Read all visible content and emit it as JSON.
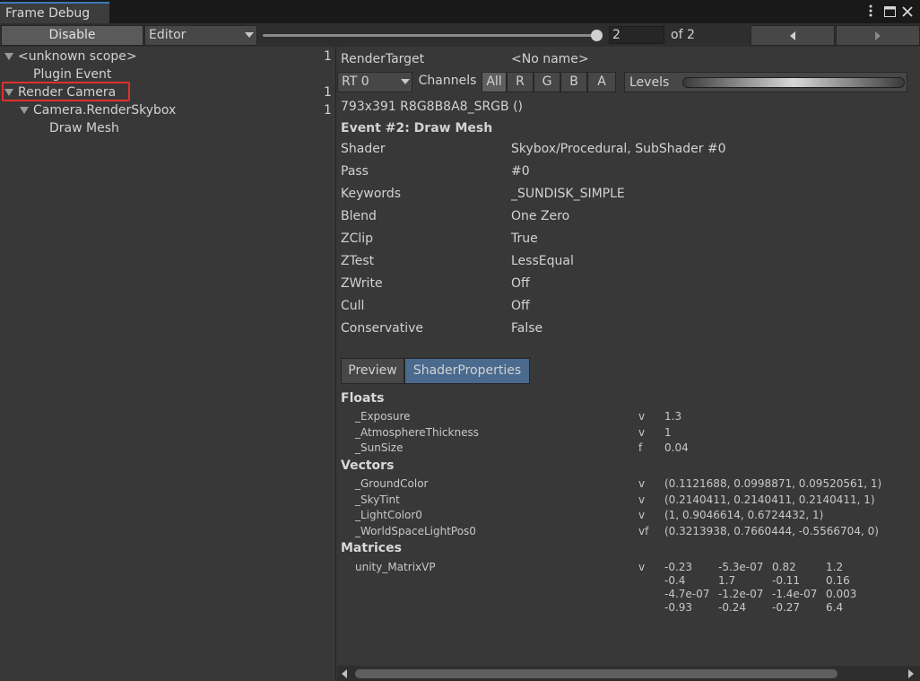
{
  "window": {
    "tab_title": "Frame Debug",
    "menu_icon": "kebab-menu-icon",
    "maximize_icon": "maximize-icon",
    "close_icon": "close-icon"
  },
  "toolbar": {
    "disable_label": "Disable",
    "editor_label": "Editor",
    "frame_value": "2",
    "frame_slider_fraction": 1.0,
    "of_label": "of 2",
    "prev_icon": "triangle-left-icon",
    "next_icon": "triangle-right-icon"
  },
  "tree": [
    {
      "label": "<unknown scope>",
      "count": "1"
    },
    {
      "label": "Plugin Event",
      "count": ""
    },
    {
      "label": "Render Camera",
      "count": "1"
    },
    {
      "label": "Camera.RenderSkybox",
      "count": "1"
    },
    {
      "label": "Draw Mesh",
      "count": ""
    }
  ],
  "highlight_color": "#e0312b",
  "details": {
    "render_target_label": "RenderTarget",
    "render_target_value": "<No name>",
    "rt_label": "RT 0",
    "channels_label": "Channels",
    "channels": [
      "All",
      "R",
      "G",
      "B",
      "A"
    ],
    "levels_label": "Levels",
    "format": "793x391 R8G8B8A8_SRGB ()",
    "event_title": "Event #2: Draw Mesh",
    "rows": [
      {
        "label": "Shader",
        "value": "Skybox/Procedural, SubShader #0"
      },
      {
        "label": "Pass",
        "value": "#0"
      },
      {
        "label": "Keywords",
        "value": "_SUNDISK_SIMPLE"
      },
      {
        "label": "Blend",
        "value": "One Zero"
      },
      {
        "label": "ZClip",
        "value": "True"
      },
      {
        "label": "ZTest",
        "value": "LessEqual"
      },
      {
        "label": "ZWrite",
        "value": "Off"
      },
      {
        "label": "Cull",
        "value": "Off"
      },
      {
        "label": "Conservative",
        "value": "False"
      }
    ],
    "tabs": [
      "Preview",
      "ShaderProperties"
    ],
    "active_tab_color": "#4a6a8e"
  },
  "shader_properties": {
    "floats_header": "Floats",
    "floats": [
      {
        "name": "_Exposure",
        "type": "v",
        "value": "1.3"
      },
      {
        "name": "_AtmosphereThickness",
        "type": "v",
        "value": "1"
      },
      {
        "name": "_SunSize",
        "type": "f",
        "value": "0.04"
      }
    ],
    "vectors_header": "Vectors",
    "vectors": [
      {
        "name": "_GroundColor",
        "type": "v",
        "value": "(0.1121688, 0.0998871, 0.09520561, 1)"
      },
      {
        "name": "_SkyTint",
        "type": "v",
        "value": "(0.2140411, 0.2140411, 0.2140411, 1)"
      },
      {
        "name": "_LightColor0",
        "type": "v",
        "value": "(1, 0.9046614, 0.6724432, 1)"
      },
      {
        "name": "_WorldSpaceLightPos0",
        "type": "vf",
        "value": "(0.3213938, 0.7660444, -0.5566704, 0)"
      }
    ],
    "matrices_header": "Matrices",
    "matrix_name": "unity_MatrixVP",
    "matrix_type": "v",
    "matrix": [
      [
        "-0.23",
        "-5.3e-07",
        "0.82",
        "1.2"
      ],
      [
        "-0.4",
        "1.7",
        "-0.11",
        "0.16"
      ],
      [
        "-4.7e-07",
        "-1.2e-07",
        "-1.4e-07",
        "0.003"
      ],
      [
        "-0.93",
        "-0.24",
        "-0.27",
        "6.4"
      ]
    ]
  }
}
